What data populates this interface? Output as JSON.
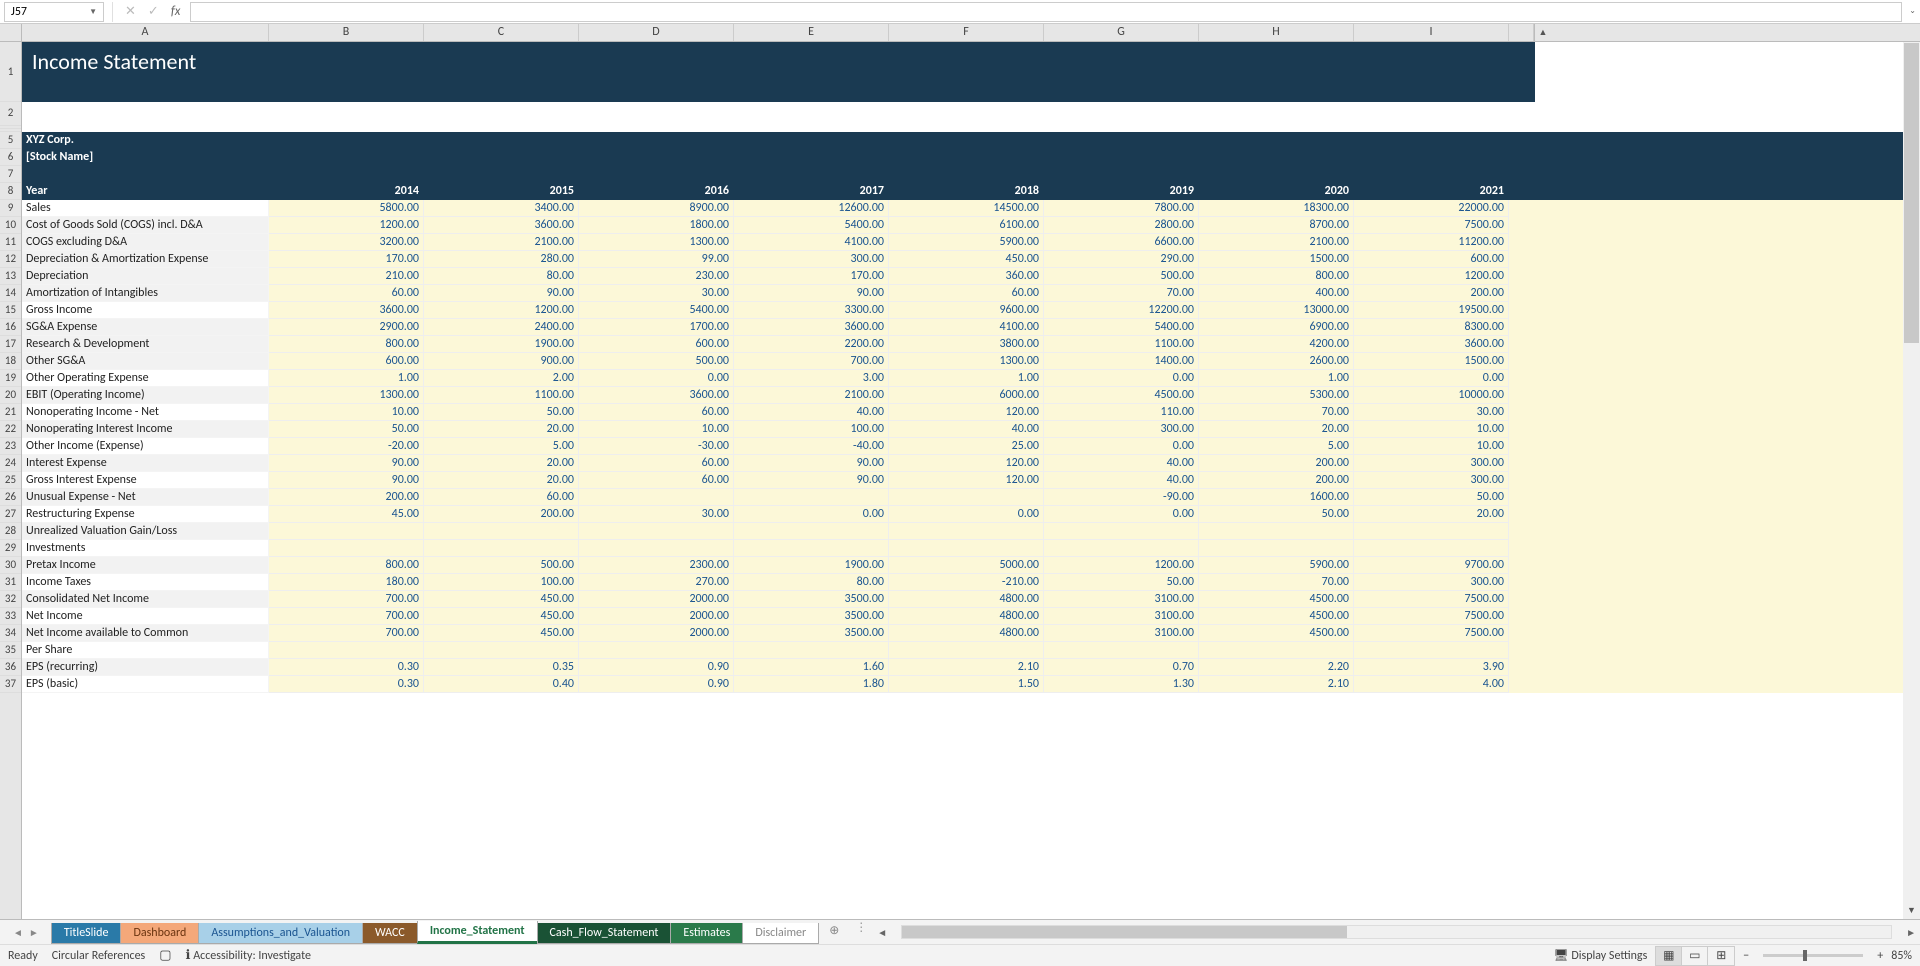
{
  "cell_ref": "J57",
  "fx_label": "fx",
  "title": "Income Statement",
  "company": "XYZ Corp.",
  "stock_name": "[Stock Name]",
  "year_label": "Year",
  "columns": [
    "A",
    "B",
    "C",
    "D",
    "E",
    "F",
    "G",
    "H",
    "I"
  ],
  "years": [
    "2014",
    "2015",
    "2016",
    "2017",
    "2018",
    "2019",
    "2020",
    "2021"
  ],
  "rows": [
    {
      "n": 9,
      "label": "Sales",
      "v": [
        "5800.00",
        "3400.00",
        "8900.00",
        "12600.00",
        "14500.00",
        "7800.00",
        "18300.00",
        "22000.00"
      ],
      "alt": false
    },
    {
      "n": 10,
      "label": "Cost of Goods Sold (COGS) incl. D&A",
      "v": [
        "1200.00",
        "3600.00",
        "1800.00",
        "5400.00",
        "6100.00",
        "2800.00",
        "8700.00",
        "7500.00"
      ],
      "alt": true
    },
    {
      "n": 11,
      "label": "COGS excluding D&A",
      "v": [
        "3200.00",
        "2100.00",
        "1300.00",
        "4100.00",
        "5900.00",
        "6600.00",
        "2100.00",
        "11200.00"
      ],
      "alt": true
    },
    {
      "n": 12,
      "label": "Depreciation & Amortization Expense",
      "v": [
        "170.00",
        "280.00",
        "99.00",
        "300.00",
        "450.00",
        "290.00",
        "1500.00",
        "600.00"
      ],
      "alt": true
    },
    {
      "n": 13,
      "label": "Depreciation",
      "v": [
        "210.00",
        "80.00",
        "230.00",
        "170.00",
        "360.00",
        "500.00",
        "800.00",
        "1200.00"
      ],
      "alt": true
    },
    {
      "n": 14,
      "label": "Amortization of Intangibles",
      "v": [
        "60.00",
        "90.00",
        "30.00",
        "90.00",
        "60.00",
        "70.00",
        "400.00",
        "200.00"
      ],
      "alt": true
    },
    {
      "n": 15,
      "label": "Gross Income",
      "v": [
        "3600.00",
        "1200.00",
        "5400.00",
        "3300.00",
        "9600.00",
        "12200.00",
        "13000.00",
        "19500.00"
      ],
      "alt": false
    },
    {
      "n": 16,
      "label": "SG&A Expense",
      "v": [
        "2900.00",
        "2400.00",
        "1700.00",
        "3600.00",
        "4100.00",
        "5400.00",
        "6900.00",
        "8300.00"
      ],
      "alt": true
    },
    {
      "n": 17,
      "label": "Research & Development",
      "v": [
        "800.00",
        "1900.00",
        "600.00",
        "2200.00",
        "3800.00",
        "1100.00",
        "4200.00",
        "3600.00"
      ],
      "alt": true
    },
    {
      "n": 18,
      "label": "Other SG&A",
      "v": [
        "600.00",
        "900.00",
        "500.00",
        "700.00",
        "1300.00",
        "1400.00",
        "2600.00",
        "1500.00"
      ],
      "alt": true
    },
    {
      "n": 19,
      "label": "Other Operating Expense",
      "v": [
        "1.00",
        "2.00",
        "0.00",
        "3.00",
        "1.00",
        "0.00",
        "1.00",
        "0.00"
      ],
      "alt": false
    },
    {
      "n": 20,
      "label": "EBIT (Operating Income)",
      "v": [
        "1300.00",
        "1100.00",
        "3600.00",
        "2100.00",
        "6000.00",
        "4500.00",
        "5300.00",
        "10000.00"
      ],
      "alt": true
    },
    {
      "n": 21,
      "label": "Nonoperating Income - Net",
      "v": [
        "10.00",
        "50.00",
        "60.00",
        "40.00",
        "120.00",
        "110.00",
        "70.00",
        "30.00"
      ],
      "alt": false
    },
    {
      "n": 22,
      "label": "Nonoperating Interest Income",
      "v": [
        "50.00",
        "20.00",
        "10.00",
        "100.00",
        "40.00",
        "300.00",
        "20.00",
        "10.00"
      ],
      "alt": true
    },
    {
      "n": 23,
      "label": "Other Income (Expense)",
      "v": [
        "-20.00",
        "5.00",
        "-30.00",
        "-40.00",
        "25.00",
        "0.00",
        "5.00",
        "10.00"
      ],
      "alt": false
    },
    {
      "n": 24,
      "label": "Interest Expense",
      "v": [
        "90.00",
        "20.00",
        "60.00",
        "90.00",
        "120.00",
        "40.00",
        "200.00",
        "300.00"
      ],
      "alt": true
    },
    {
      "n": 25,
      "label": "Gross Interest Expense",
      "v": [
        "90.00",
        "20.00",
        "60.00",
        "90.00",
        "120.00",
        "40.00",
        "200.00",
        "300.00"
      ],
      "alt": false
    },
    {
      "n": 26,
      "label": "Unusual Expense - Net",
      "v": [
        "200.00",
        "60.00",
        "",
        "",
        "",
        "-90.00",
        "1600.00",
        "50.00"
      ],
      "alt": true
    },
    {
      "n": 27,
      "label": "Restructuring Expense",
      "v": [
        "45.00",
        "200.00",
        "30.00",
        "0.00",
        "0.00",
        "0.00",
        "50.00",
        "20.00"
      ],
      "alt": false
    },
    {
      "n": 28,
      "label": "Unrealized Valuation Gain/Loss",
      "v": [
        "",
        "",
        "",
        "",
        "",
        "",
        "",
        ""
      ],
      "alt": true
    },
    {
      "n": 29,
      "label": "Investments",
      "v": [
        "",
        "",
        "",
        "",
        "",
        "",
        "",
        ""
      ],
      "alt": false
    },
    {
      "n": 30,
      "label": "Pretax Income",
      "v": [
        "800.00",
        "500.00",
        "2300.00",
        "1900.00",
        "5000.00",
        "1200.00",
        "5900.00",
        "9700.00"
      ],
      "alt": true
    },
    {
      "n": 31,
      "label": "Income Taxes",
      "v": [
        "180.00",
        "100.00",
        "270.00",
        "80.00",
        "-210.00",
        "50.00",
        "70.00",
        "300.00"
      ],
      "alt": false
    },
    {
      "n": 32,
      "label": "Consolidated Net Income",
      "v": [
        "700.00",
        "450.00",
        "2000.00",
        "3500.00",
        "4800.00",
        "3100.00",
        "4500.00",
        "7500.00"
      ],
      "alt": true
    },
    {
      "n": 33,
      "label": "Net Income",
      "v": [
        "700.00",
        "450.00",
        "2000.00",
        "3500.00",
        "4800.00",
        "3100.00",
        "4500.00",
        "7500.00"
      ],
      "alt": false
    },
    {
      "n": 34,
      "label": "Net Income available to Common",
      "v": [
        "700.00",
        "450.00",
        "2000.00",
        "3500.00",
        "4800.00",
        "3100.00",
        "4500.00",
        "7500.00"
      ],
      "alt": true
    },
    {
      "n": 35,
      "label": "Per Share",
      "v": [
        "",
        "",
        "",
        "",
        "",
        "",
        "",
        ""
      ],
      "alt": false
    },
    {
      "n": 36,
      "label": "EPS (recurring)",
      "v": [
        "0.30",
        "0.35",
        "0.90",
        "1.60",
        "2.10",
        "0.70",
        "2.20",
        "3.90"
      ],
      "alt": true
    },
    {
      "n": 37,
      "label": "EPS (basic)",
      "v": [
        "0.30",
        "0.40",
        "0.90",
        "1.80",
        "1.50",
        "1.30",
        "2.10",
        "4.00"
      ],
      "alt": false
    }
  ],
  "tabs": [
    {
      "label": "TitleSlide",
      "cls": "blue"
    },
    {
      "label": "Dashboard",
      "cls": "orange"
    },
    {
      "label": "Assumptions_and_Valuation",
      "cls": "ltblue"
    },
    {
      "label": "WACC",
      "cls": "brown"
    },
    {
      "label": "Income_Statement",
      "cls": "active"
    },
    {
      "label": "Cash_Flow_Statement",
      "cls": "dkgreen"
    },
    {
      "label": "Estimates",
      "cls": "green2"
    },
    {
      "label": "Disclaimer",
      "cls": "disclaimer"
    }
  ],
  "status": {
    "ready": "Ready",
    "circular": "Circular References",
    "a11y": "Accessibility: Investigate",
    "display": "Display Settings",
    "zoom": "85%"
  }
}
